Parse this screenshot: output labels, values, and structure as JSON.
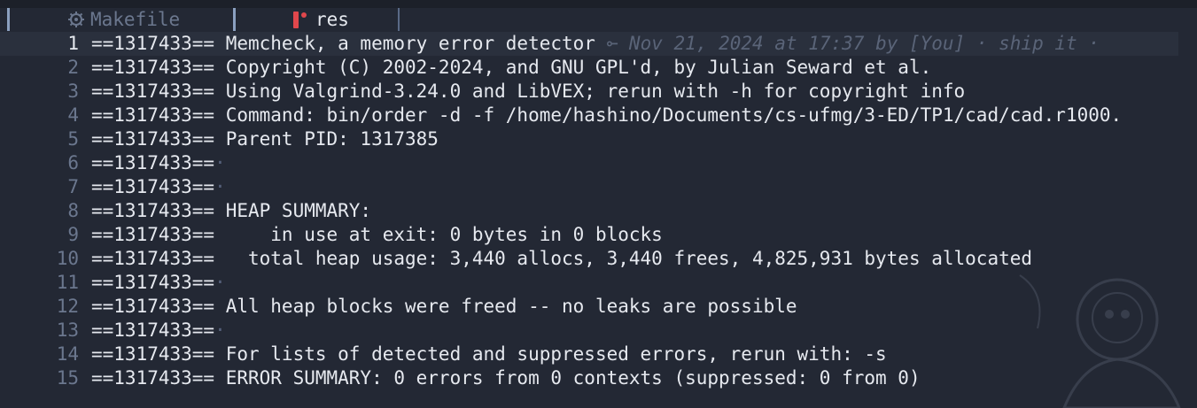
{
  "tabs": [
    {
      "label": "Makefile",
      "icon": "gear-icon",
      "active": false
    },
    {
      "label": "res",
      "icon": "ruby-icon",
      "active": true
    }
  ],
  "colors": {
    "background": "#232834",
    "text": "#e6e9ef",
    "line_number": "#6b778e",
    "tab_separator": "#8ba0c0",
    "ruby_icon": "#e0474c"
  },
  "editor": {
    "current_line": 1,
    "blame": {
      "text": "Nov 21, 2024 at 17:37 by [You] · ship it ·",
      "icon": "commit-icon"
    },
    "lines": [
      {
        "num": "1",
        "text": "==1317433== Memcheck, a memory error detector"
      },
      {
        "num": "2",
        "text": "==1317433== Copyright (C) 2002-2024, and GNU GPL'd, by Julian Seward et al."
      },
      {
        "num": "3",
        "text": "==1317433== Using Valgrind-3.24.0 and LibVEX; rerun with -h for copyright info"
      },
      {
        "num": "4",
        "text": "==1317433== Command: bin/order -d -f /home/hashino/Documents/cs-ufmg/3-ED/TP1/cad/cad.r1000."
      },
      {
        "num": "5",
        "text": "==1317433== Parent PID: 1317385"
      },
      {
        "num": "6",
        "text": "==1317433==",
        "eol": "·"
      },
      {
        "num": "7",
        "text": "==1317433==",
        "eol": "·"
      },
      {
        "num": "8",
        "text": "==1317433== HEAP SUMMARY:"
      },
      {
        "num": "9",
        "text": "==1317433==     in use at exit: 0 bytes in 0 blocks"
      },
      {
        "num": "10",
        "text": "==1317433==   total heap usage: 3,440 allocs, 3,440 frees, 4,825,931 bytes allocated"
      },
      {
        "num": "11",
        "text": "==1317433==",
        "eol": "·"
      },
      {
        "num": "12",
        "text": "==1317433== All heap blocks were freed -- no leaks are possible"
      },
      {
        "num": "13",
        "text": "==1317433==",
        "eol": "·"
      },
      {
        "num": "14",
        "text": "==1317433== For lists of detected and suppressed errors, rerun with: -s"
      },
      {
        "num": "15",
        "text": "==1317433== ERROR SUMMARY: 0 errors from 0 contexts (suppressed: 0 from 0)"
      }
    ]
  }
}
